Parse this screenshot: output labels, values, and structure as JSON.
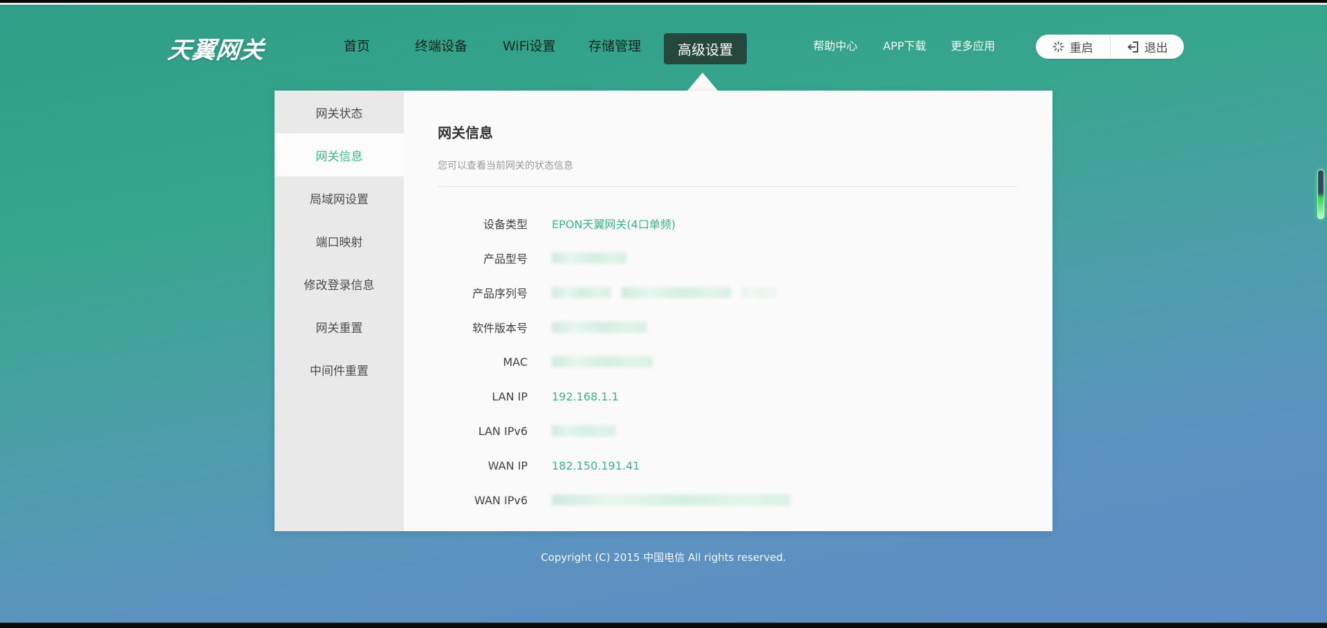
{
  "header": {
    "logo": "天翼网关",
    "nav": [
      {
        "label": "首页",
        "active": false
      },
      {
        "label": "终端设备",
        "active": false
      },
      {
        "label": "WiFi设置",
        "active": false
      },
      {
        "label": "存储管理",
        "active": false
      },
      {
        "label": "高级设置",
        "active": true
      }
    ],
    "links": [
      {
        "label": "帮助中心"
      },
      {
        "label": "APP下载"
      },
      {
        "label": "更多应用"
      }
    ],
    "actions": {
      "restart_label": "重启",
      "logout_label": "退出"
    }
  },
  "sidebar": {
    "items": [
      {
        "label": "网关状态",
        "active": false
      },
      {
        "label": "网关信息",
        "active": true
      },
      {
        "label": "局域网设置",
        "active": false
      },
      {
        "label": "端口映射",
        "active": false
      },
      {
        "label": "修改登录信息",
        "active": false
      },
      {
        "label": "网关重置",
        "active": false
      },
      {
        "label": "中间件重置",
        "active": false
      }
    ]
  },
  "content": {
    "title": "网关信息",
    "subtitle": "您可以查看当前网关的状态信息",
    "rows": [
      {
        "label": "设备类型",
        "value": "EPON天翼网关(4口单频)",
        "redacted": false
      },
      {
        "label": "产品型号",
        "value": "",
        "redacted": true
      },
      {
        "label": "产品序列号",
        "value": "",
        "redacted": true
      },
      {
        "label": "软件版本号",
        "value": "",
        "redacted": true
      },
      {
        "label": "MAC",
        "value": "",
        "redacted": true
      },
      {
        "label": "LAN IP",
        "value": "192.168.1.1",
        "redacted": false
      },
      {
        "label": "LAN IPv6",
        "value": "",
        "redacted": true
      },
      {
        "label": "WAN IP",
        "value": "182.150.191.41",
        "redacted": false
      },
      {
        "label": "WAN IPv6",
        "value": "",
        "redacted": true
      }
    ]
  },
  "footer": {
    "copyright": "Copyright (C) 2015 中国电信 All rights reserved."
  },
  "colors": {
    "accent_green": "#3cb88c",
    "active_tab_bg": "#26473b",
    "background_top": "#2f9e87",
    "background_bottom": "#5f8dc5"
  },
  "icons": {
    "restart": "spinner-icon",
    "logout": "logout-icon"
  }
}
